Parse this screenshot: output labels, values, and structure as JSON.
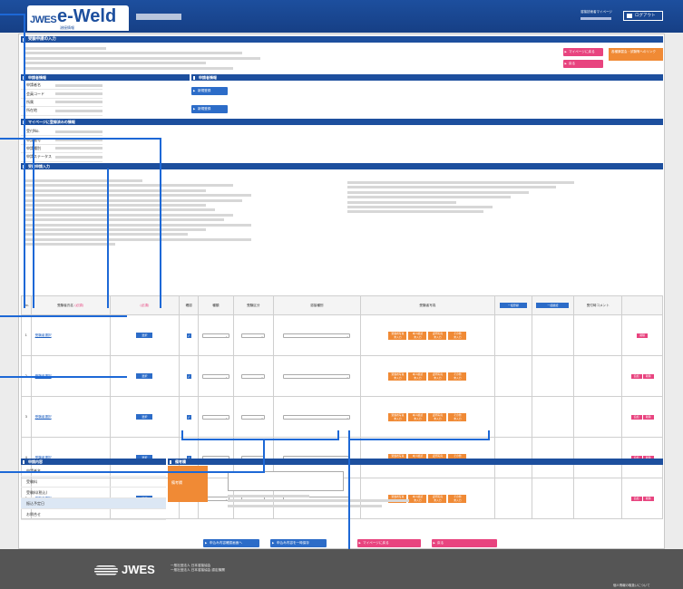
{
  "header": {
    "logo_jwes": "JWES",
    "logo_eweld": "e-Weld",
    "logo_sub": "溶接情報",
    "user_label": "溶接技術者マイページ",
    "logout_label": "ログアウト"
  },
  "page": {
    "title": "受験申請の入力",
    "btn_mypage": "マイページに戻る",
    "btn_back": "戻る",
    "btn_orange_label": "各種講習会・試験等へのリンク"
  },
  "section_applicant": {
    "title": "申請者情報",
    "fields": [
      "申請者名",
      "会員コード",
      "所属",
      "所在地"
    ],
    "btn_1": "新規登録",
    "btn_2": "新規登録"
  },
  "section_mypage": {
    "title": "マイページに登録済みの情報",
    "fields": [
      "受付No.",
      "申請番号",
      "申請種別",
      "申請ステータス"
    ]
  },
  "section_input": {
    "title": "受験申請入力"
  },
  "table": {
    "headers": {
      "no": "No.",
      "name": "受験者氏名",
      "check": "確認",
      "select1": "種類",
      "select2": "受験区分",
      "select3": "溶接種別",
      "photos": "受験者写真",
      "btn_bulk": "一括登録",
      "btn_bulk_check": "一括確認",
      "comment": "受付時コメント"
    },
    "rows": [
      {
        "no": "1",
        "link": "受験者選択",
        "btn": "選択",
        "del": "削除"
      },
      {
        "no": "2",
        "link": "受験者選択",
        "btn": "選択",
        "del": "削除"
      },
      {
        "no": "3",
        "link": "受験者選択",
        "btn": "選択",
        "del": "削除"
      },
      {
        "no": "4",
        "link": "受験者選択",
        "btn": "選択",
        "del": "削除"
      },
      {
        "no": "5",
        "link": "受験者選択",
        "btn": "選択",
        "del": "削除"
      }
    ],
    "photo_labels": [
      "受験者写真",
      "本人確認",
      "証明写真",
      "その他"
    ],
    "photo_sub": "未入力",
    "add_label": "追加"
  },
  "section_payment": {
    "title": "申請内容",
    "fields": [
      "申請者名",
      "受験料",
      "受験料(税込)",
      "振込予定日",
      "お問合せ"
    ]
  },
  "section_remarks": {
    "title": "備考欄",
    "label": "備考欄"
  },
  "bottom_buttons": [
    "申込み内容確認画面へ",
    "申込み内容を一時保存",
    "マイページに戻る",
    "戻る"
  ],
  "footer": {
    "logo": "JWES",
    "org_line1": "一般社団法人 日本溶接協会",
    "org_line2": "一般社団法人 日本溶接協会 認定機関",
    "link": "個人情報の取扱いについて"
  },
  "colors": {
    "header_blue": "#1d4f9e",
    "accent_pink": "#e8447f",
    "accent_orange": "#f08a35",
    "button_blue": "#2c6cc8",
    "annotation_line": "#1d68d6"
  }
}
